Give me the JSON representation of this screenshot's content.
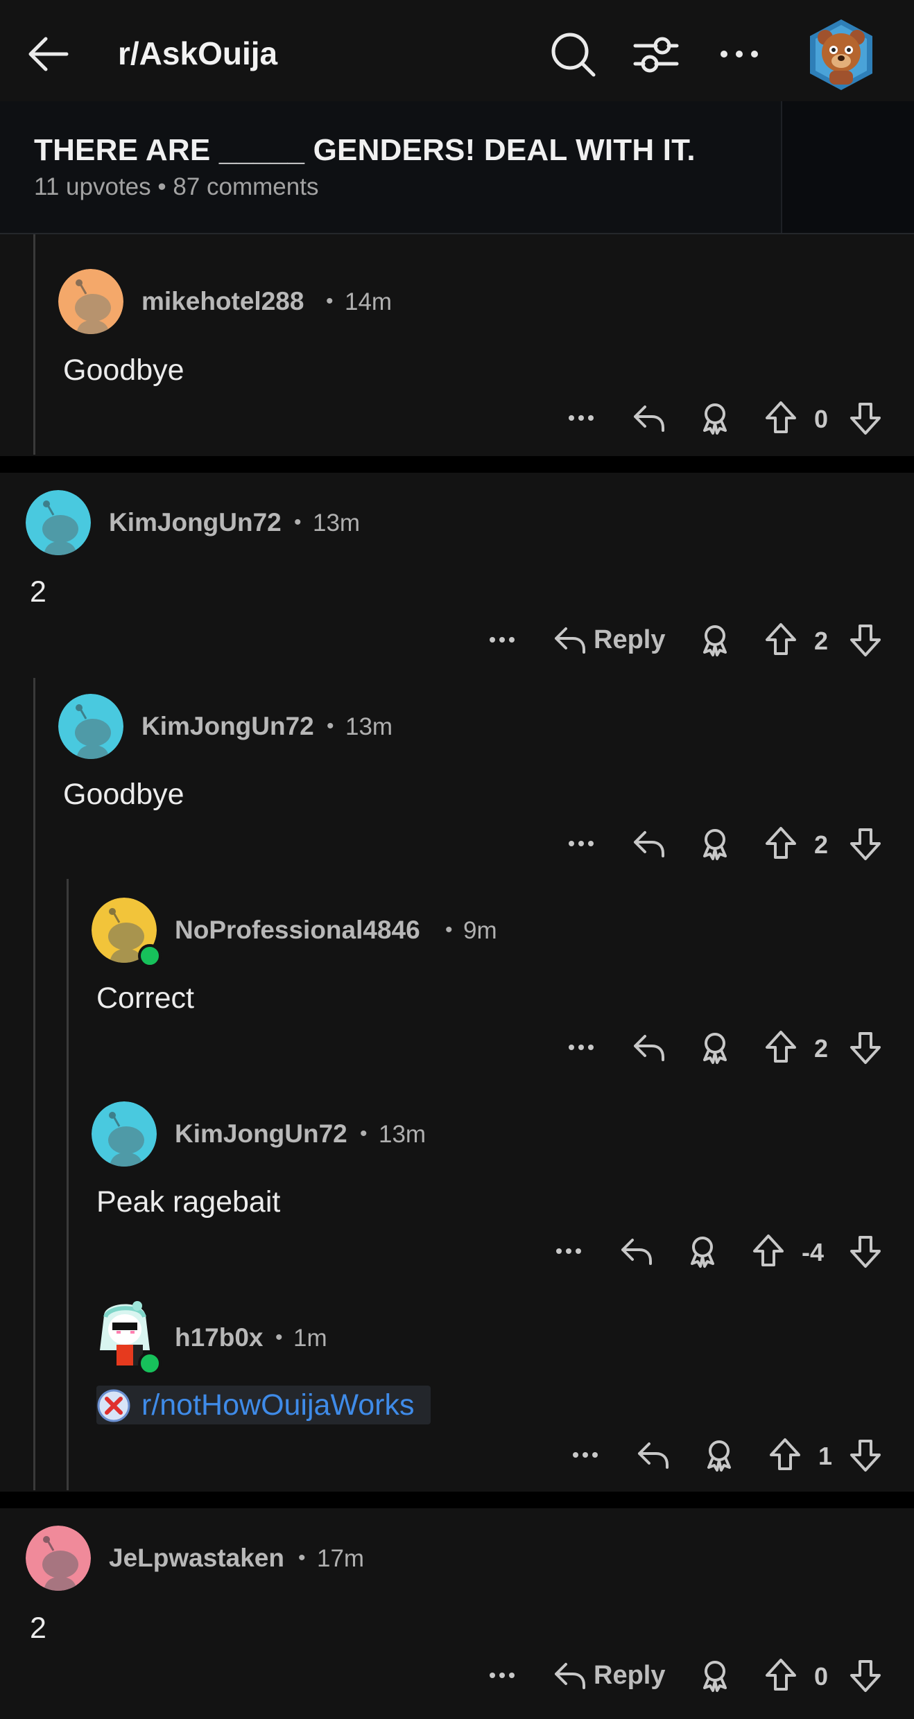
{
  "header": {
    "subreddit": "r/AskOuija",
    "icons": [
      "back-arrow-icon",
      "search-icon",
      "filter-icon",
      "more-icon",
      "user-avatar-bear"
    ]
  },
  "post": {
    "title": "THERE ARE _____ GENDERS! DEAL WITH IT.",
    "upvotes": "11 upvotes",
    "comments": "87 comments"
  },
  "comments": [
    {
      "user": "mikehotel288",
      "time": "14m",
      "body": "Goodbye",
      "votes": "0",
      "avatar_color": "#f4a86a"
    },
    {
      "user": "KimJongUn72",
      "time": "13m",
      "body": "2",
      "votes": "2",
      "reply_label": "Reply",
      "avatar_color": "#49c9df"
    },
    {
      "user": "KimJongUn72",
      "time": "13m",
      "body": "Goodbye",
      "votes": "2",
      "avatar_color": "#49c9df"
    },
    {
      "user": "NoProfessional4846",
      "time": "9m",
      "body": "Correct",
      "votes": "2",
      "avatar_color": "#f2c43a"
    },
    {
      "user": "KimJongUn72",
      "time": "13m",
      "body": "Peak ragebait",
      "votes": "-4",
      "avatar_color": "#49c9df"
    },
    {
      "user": "h17b0x",
      "time": "1m",
      "body": "r/notHowOuijaWorks",
      "votes": "1",
      "avatar_color": "#ffffff"
    },
    {
      "user": "JeLpwastaken",
      "time": "17m",
      "body": "2",
      "votes": "0",
      "reply_label": "Reply",
      "avatar_color": "#f08a9a"
    }
  ],
  "colors": {
    "background": "#131313",
    "link": "#3f8be8",
    "online": "#17c15b"
  }
}
